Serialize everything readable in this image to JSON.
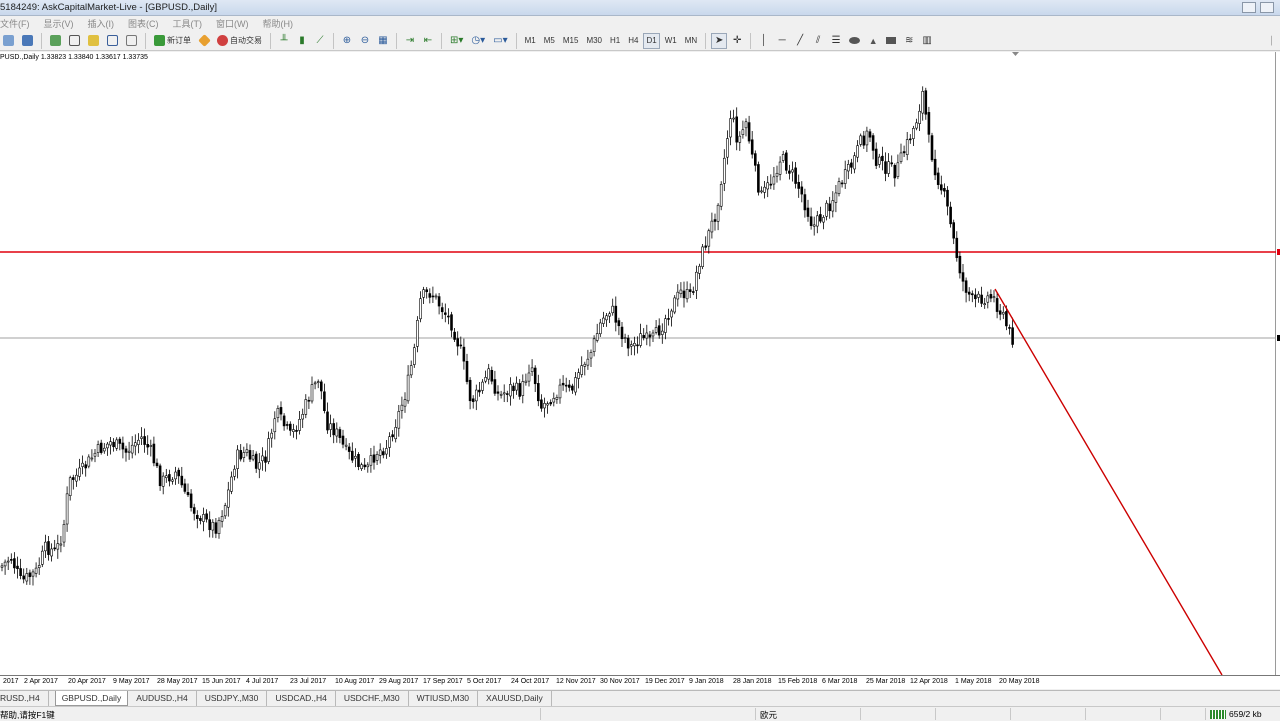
{
  "window": {
    "title": "5184249: AskCapitalMarket-Live - [GBPUSD.,Daily]"
  },
  "menu": [
    "文件(F)",
    "显示(V)",
    "插入(I)",
    "图表(C)",
    "工具(T)",
    "窗口(W)",
    "帮助(H)"
  ],
  "toolbar": {
    "new_order_label": "新订单",
    "autotrade_label": "自动交易",
    "timeframes": [
      "M1",
      "M5",
      "M15",
      "M30",
      "H1",
      "H4",
      "D1",
      "W1",
      "MN"
    ],
    "selected_timeframe": "D1"
  },
  "chart": {
    "info": "PUSD.,Daily  1.33823 1.33840 1.33617 1.33735",
    "symbol": "GBPUSD.",
    "period": "Daily",
    "ohlc": {
      "open": 1.33823,
      "high": 1.3384,
      "low": 1.33617,
      "close": 1.33735
    },
    "horizontal_line_color": "#e0000f",
    "trendline_color": "#cc0000",
    "bid_line_color": "#a0a0a0",
    "date_labels": [
      "2017",
      "2 Apr 2017",
      "20 Apr 2017",
      "9 May 2017",
      "28 May 2017",
      "15 Jun 2017",
      "4 Jul 2017",
      "23 Jul 2017",
      "10 Aug 2017",
      "29 Aug 2017",
      "17 Sep 2017",
      "5 Oct 2017",
      "24 Oct 2017",
      "12 Nov 2017",
      "30 Nov 2017",
      "19 Dec 2017",
      "9 Jan 2018",
      "28 Jan 2018",
      "15 Feb 2018",
      "6 Mar 2018",
      "25 Mar 2018",
      "12 Apr 2018",
      "1 May 2018",
      "20 May 2018"
    ]
  },
  "tabs": [
    "RUSD.,H4",
    "GBPUSD.,Daily",
    "AUDUSD.,H4",
    "USDJPY.,M30",
    "USDCAD.,H4",
    "USDCHF.,M30",
    "WTIUSD,M30",
    "XAUUSD,Daily"
  ],
  "active_tab": "GBPUSD.,Daily",
  "status": {
    "help": "帮助,请按F1键",
    "profile": "欧元",
    "traffic": "659/2 kb"
  }
}
